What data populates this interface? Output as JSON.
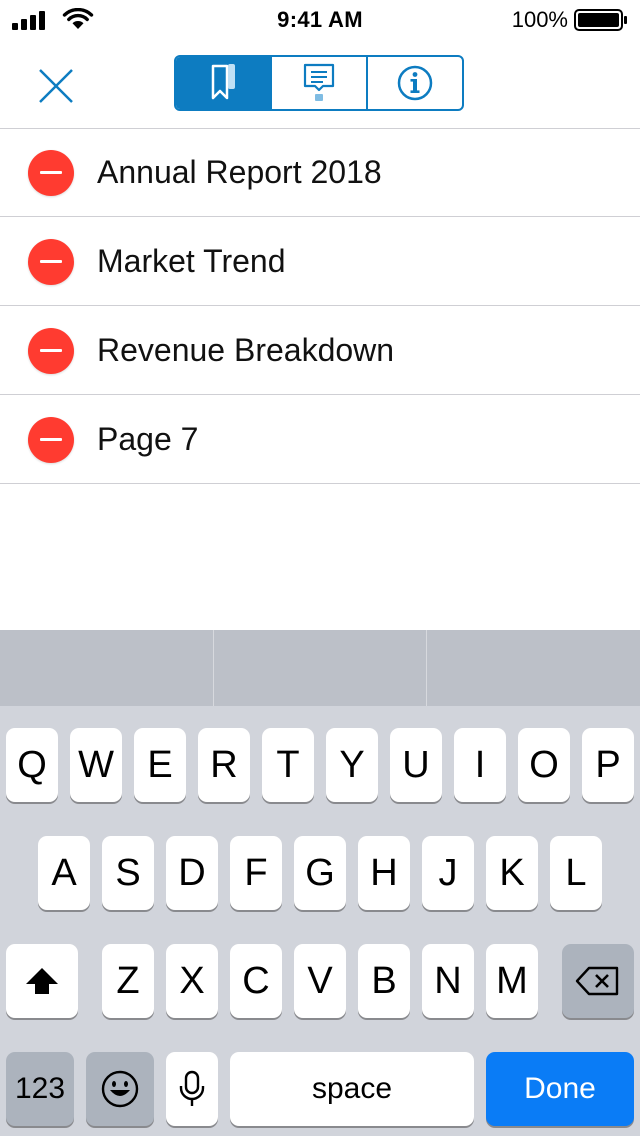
{
  "status_bar": {
    "time": "9:41 AM",
    "battery_percent": "100%",
    "battery_level": 1.0,
    "signal_bars": 4
  },
  "nav": {
    "close_icon": "close-x-icon",
    "segments": [
      {
        "icon": "bookmark-icon",
        "selected": true
      },
      {
        "icon": "comment-icon",
        "selected": false
      },
      {
        "icon": "info-icon",
        "selected": false
      }
    ]
  },
  "bookmarks": [
    {
      "label": "Annual Report 2018"
    },
    {
      "label": "Market Trend"
    },
    {
      "label": "Revenue Breakdown"
    },
    {
      "label": "Page 7"
    }
  ],
  "keyboard": {
    "row1": [
      "Q",
      "W",
      "E",
      "R",
      "T",
      "Y",
      "U",
      "I",
      "O",
      "P"
    ],
    "row2": [
      "A",
      "S",
      "D",
      "F",
      "G",
      "H",
      "J",
      "K",
      "L"
    ],
    "row3": [
      "Z",
      "X",
      "C",
      "V",
      "B",
      "N",
      "M"
    ],
    "numbers_label": "123",
    "space_label": "space",
    "done_label": "Done",
    "emoji_icon": "emoji-icon",
    "mic_icon": "microphone-icon",
    "shift_icon": "shift-icon",
    "backspace_icon": "backspace-icon"
  },
  "colors": {
    "accent": "#0d7cc1",
    "delete": "#ff3b30",
    "done": "#0a7cf6"
  }
}
